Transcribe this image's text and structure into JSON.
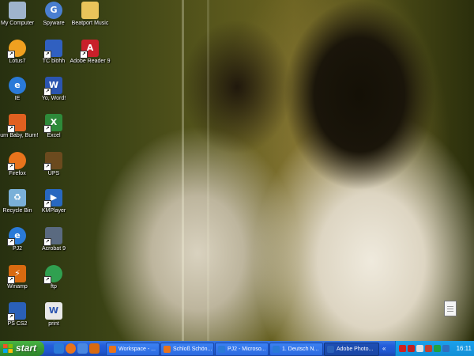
{
  "desktop": {
    "icons": [
      {
        "label": "My Computer",
        "icon": "computer-icon",
        "color": "#9fb4cc"
      },
      {
        "label": "Spyware",
        "icon": "spyware-icon",
        "color": "#4a7fd0"
      },
      {
        "label": "Beatport Music",
        "icon": "folder-icon",
        "color": "#e9c45a"
      },
      {
        "label": "Lotus7",
        "icon": "lotus-icon",
        "color": "#f0a020"
      },
      {
        "label": "TC blöhh",
        "icon": "total-commander-icon",
        "color": "#3060c0"
      },
      {
        "label": "Adobe Reader 9",
        "icon": "adobe-reader-icon",
        "color": "#c8202a"
      },
      {
        "label": "IE",
        "icon": "internet-explorer-icon",
        "color": "#2a7ad8"
      },
      {
        "label": "Yo, Word!",
        "icon": "word-icon",
        "color": "#2b55b0"
      },
      {
        "label": "Burn Baby, Burn!",
        "icon": "burn-icon",
        "color": "#e06020"
      },
      {
        "label": "Excel",
        "icon": "excel-icon",
        "color": "#2e8a3a"
      },
      {
        "label": "Firefox",
        "icon": "firefox-icon",
        "color": "#e8731c"
      },
      {
        "label": "UPS",
        "icon": "ups-icon",
        "color": "#6b4a1e"
      },
      {
        "label": "Recycle Bin",
        "icon": "recycle-bin-icon",
        "color": "#7ab0d8"
      },
      {
        "label": "KMPlayer",
        "icon": "kmplayer-icon",
        "color": "#2868c0"
      },
      {
        "label": "PJ2",
        "icon": "pj2-icon",
        "color": "#2a7ad8"
      },
      {
        "label": "Acrobat 9",
        "icon": "acrobat-icon",
        "color": "#5a6a80"
      },
      {
        "label": "Winamp",
        "icon": "winamp-icon",
        "color": "#d86a10"
      },
      {
        "label": "ftp",
        "icon": "ftp-icon",
        "color": "#30a050"
      },
      {
        "label": "PS CS2",
        "icon": "photoshop-icon",
        "color": "#2a60b8"
      },
      {
        "label": "print",
        "icon": "print-icon",
        "color": "#e8e8e8"
      }
    ]
  },
  "taskbar": {
    "start_label": "start",
    "quick_launch": [
      {
        "icon": "ie-quicklaunch-icon",
        "color": "#2a7ad8"
      },
      {
        "icon": "firefox-quicklaunch-icon",
        "color": "#e8731c"
      },
      {
        "icon": "show-desktop-icon",
        "color": "#4a88e0"
      },
      {
        "icon": "media-quicklaunch-icon",
        "color": "#d86a10"
      }
    ],
    "tasks": [
      {
        "title": "Workspace - ...",
        "icon": "firefox-task-icon",
        "color": "#e8731c"
      },
      {
        "title": "Schloß Schön...",
        "icon": "firefox-task-icon",
        "color": "#e8731c"
      },
      {
        "title": "PJ2 - Microso...",
        "icon": "ie-task-icon",
        "color": "#2a7ad8"
      },
      {
        "title": "1. Deutsch N...",
        "icon": "ie-task-icon",
        "color": "#2a7ad8"
      },
      {
        "title": "Adobe Photo...",
        "icon": "photoshop-task-icon",
        "color": "#2a60b8"
      }
    ],
    "tray": {
      "icons": [
        {
          "icon": "network-tray-icon",
          "color": "#d02020"
        },
        {
          "icon": "ati-tray-icon",
          "color": "#c02020"
        },
        {
          "icon": "volume-tray-icon",
          "color": "#e0e0e0"
        },
        {
          "icon": "antivirus-tray-icon",
          "color": "#c04030"
        },
        {
          "icon": "security-tray-icon",
          "color": "#20a040"
        },
        {
          "icon": "messenger-tray-icon",
          "color": "#3070c0"
        }
      ],
      "clock": "16:11"
    }
  }
}
